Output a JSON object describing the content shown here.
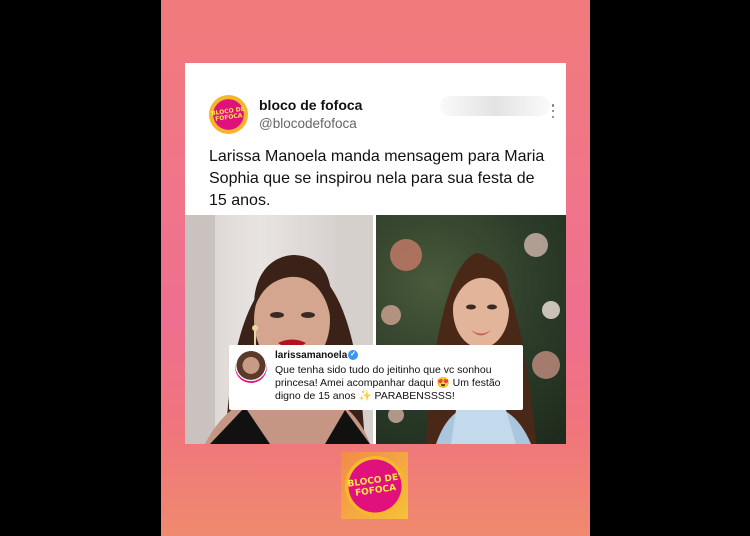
{
  "tweet": {
    "account_name": "bloco de fofoca",
    "handle": "@blocodefofoca",
    "logo_text": "BLOCO DE FOFOCA",
    "text": "Larissa Manoela manda mensagem para Maria Sophia que se inspirou nela para sua festa de 15 anos."
  },
  "comment": {
    "username": "larissamanoela",
    "verified_mark": "✓",
    "text": "Que tenha sido tudo do jeitinho que vc sonhou princesa! Amei acompanhar daqui 😍 Um festão digno de 15 anos ✨ PARABENSSSS!"
  },
  "footer": {
    "logo_text": "BLOCO DE' FOFOCA"
  },
  "colors": {
    "brand_pink": "#e0117d",
    "brand_yellow": "#ffe94a",
    "verified_blue": "#3897f0",
    "story_background": "#f0758a"
  },
  "icons": {
    "more": "more-vertical-icon",
    "verified": "verified-badge-icon"
  }
}
